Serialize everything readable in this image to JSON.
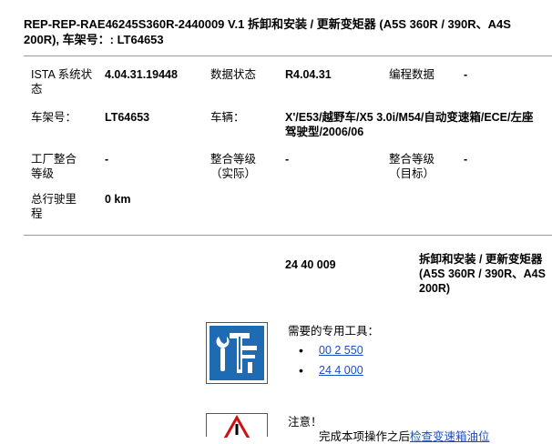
{
  "header": {
    "title": "REP-REP-RAE46245S360R-2440009   V.1   拆卸和安装 / 更新变矩器 (A5S 360R / 390R、A4S 200R), 车架号：: LT64653"
  },
  "info": {
    "ista_label": "ISTA 系统状态",
    "ista_value": "4.04.31.19448",
    "data_status_label": "数据状态",
    "data_status_value": "R4.04.31",
    "programming_label": "编程数据",
    "programming_value": "-",
    "vin_label": "车架号：",
    "vin_value": "LT64653",
    "vehicle_label": "车辆：",
    "vehicle_value": "X'/E53/越野车/X5 3.0i/M54/自动变速箱/ECE/左座驾驶型/2006/06",
    "factory_level_label": "工厂整合等级",
    "factory_level_value": "-",
    "actual_level_label": "整合等级（实际）",
    "actual_level_value": "-",
    "target_level_label": "整合等级（目标）",
    "target_level_value": "-",
    "mileage_label": "总行驶里程",
    "mileage_value": "0 km"
  },
  "repair": {
    "code": "24 40 009",
    "description": "拆卸和安装 / 更新变矩器 (A5S 360R / 390R、A4S 200R)"
  },
  "tools": {
    "title": "需要的专用工具：",
    "icon": "special-tools-icon",
    "items": [
      "00 2 550",
      "24 4 000"
    ]
  },
  "notice": {
    "title": "注意！",
    "icon": "warning-triangle-icon",
    "text_prefix": "完成本项操作之后",
    "text_link": "检查变速箱油位"
  },
  "colors": {
    "link": "#1a4fc4",
    "icon_blue": "#1e6bb4",
    "divider": "#999999"
  }
}
